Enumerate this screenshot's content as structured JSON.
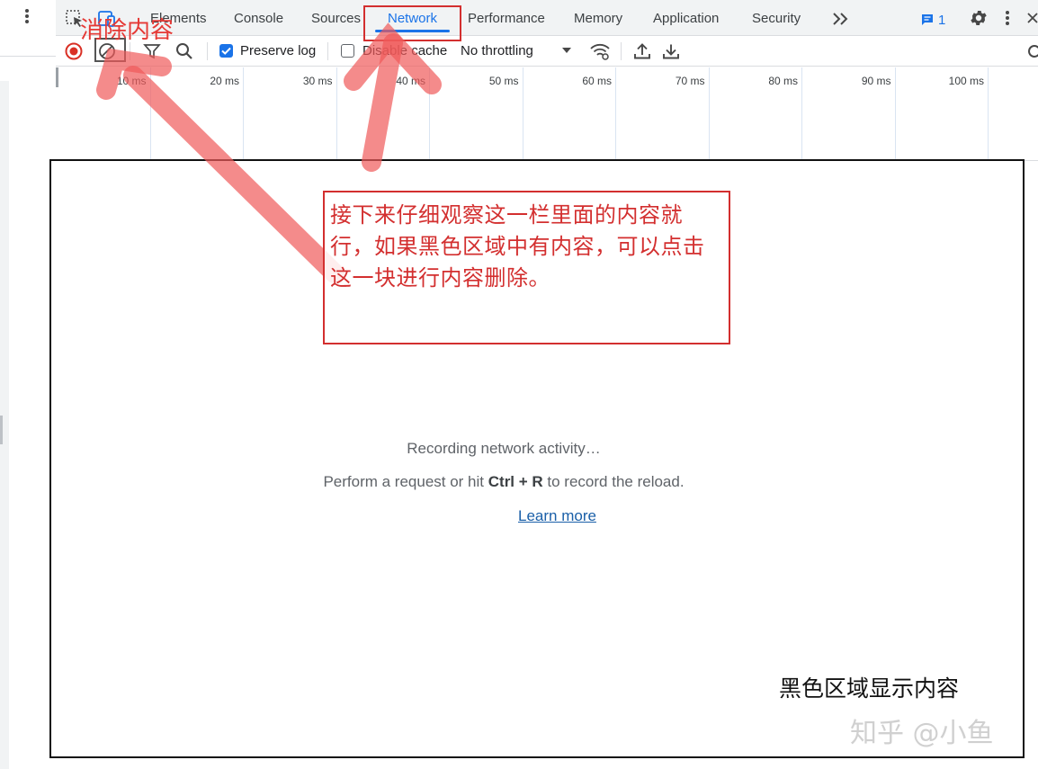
{
  "tabs": [
    {
      "label": "Elements"
    },
    {
      "label": "Console"
    },
    {
      "label": "Sources"
    },
    {
      "label": "Network",
      "active": true
    },
    {
      "label": "Performance"
    },
    {
      "label": "Memory"
    },
    {
      "label": "Application"
    },
    {
      "label": "Security"
    }
  ],
  "issues": {
    "count": "1"
  },
  "toolbar": {
    "preserve_log": {
      "label": "Preserve log",
      "checked": true
    },
    "disable_cache": {
      "label": "Disable cache",
      "checked": false
    },
    "throttling": {
      "selected": "No throttling"
    }
  },
  "timeline": {
    "ticks": [
      "10 ms",
      "20 ms",
      "30 ms",
      "40 ms",
      "50 ms",
      "60 ms",
      "70 ms",
      "80 ms",
      "90 ms",
      "100 ms"
    ]
  },
  "empty_state": {
    "recording": "Recording network activity…",
    "hint_before": "Perform a request or hit ",
    "hint_keys": "Ctrl + R",
    "hint_after": " to record the reload.",
    "learn_more": "Learn more"
  },
  "annotations": {
    "clear_label": "消除内容",
    "callout": "接下来仔细观察这一栏里面的内容就行，如果黑色区域中有内容，可以点击这一块进行内容删除。",
    "black_area_label": "黑色区域显示内容",
    "watermark": "知乎 @小鱼"
  },
  "colors": {
    "accent": "#1a73e8",
    "annotation_red": "#d32f2f",
    "record_red": "#d93025"
  }
}
